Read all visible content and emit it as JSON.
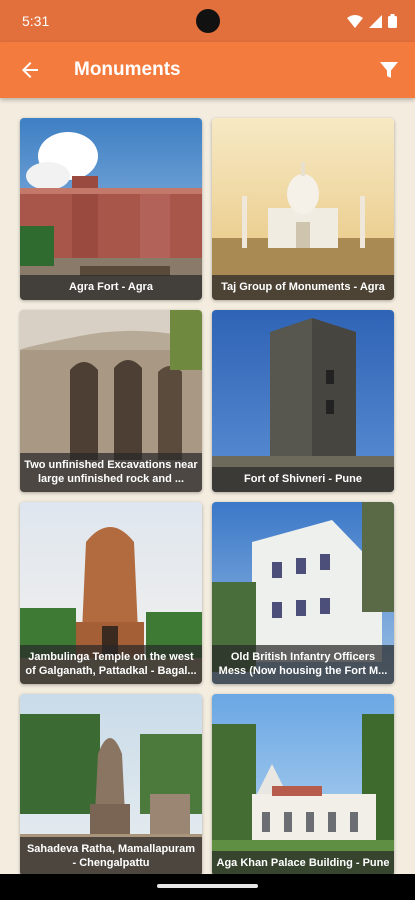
{
  "status_bar": {
    "time": "5:31"
  },
  "app_bar": {
    "title": "Monuments"
  },
  "monuments": [
    {
      "name": "Agra Fort - Agra"
    },
    {
      "name": "Taj Group of Monuments - Agra"
    },
    {
      "name": "Two unfinished Excavations near large unfinished rock and ..."
    },
    {
      "name": "Fort of Shivneri  - Pune"
    },
    {
      "name": "Jambulinga Temple on the west of Galganath, Pattadkal - Bagal..."
    },
    {
      "name": "Old British Infantry Officers Mess (Now housing the Fort M..."
    },
    {
      "name": "Sahadeva Ratha, Mamallapuram - Chengalpattu"
    },
    {
      "name": "Aga Khan Palace Building - Pune"
    }
  ],
  "colors": {
    "status_bar": "#e2703d",
    "app_bar": "#f47b3e",
    "background": "#f3ecdf"
  }
}
